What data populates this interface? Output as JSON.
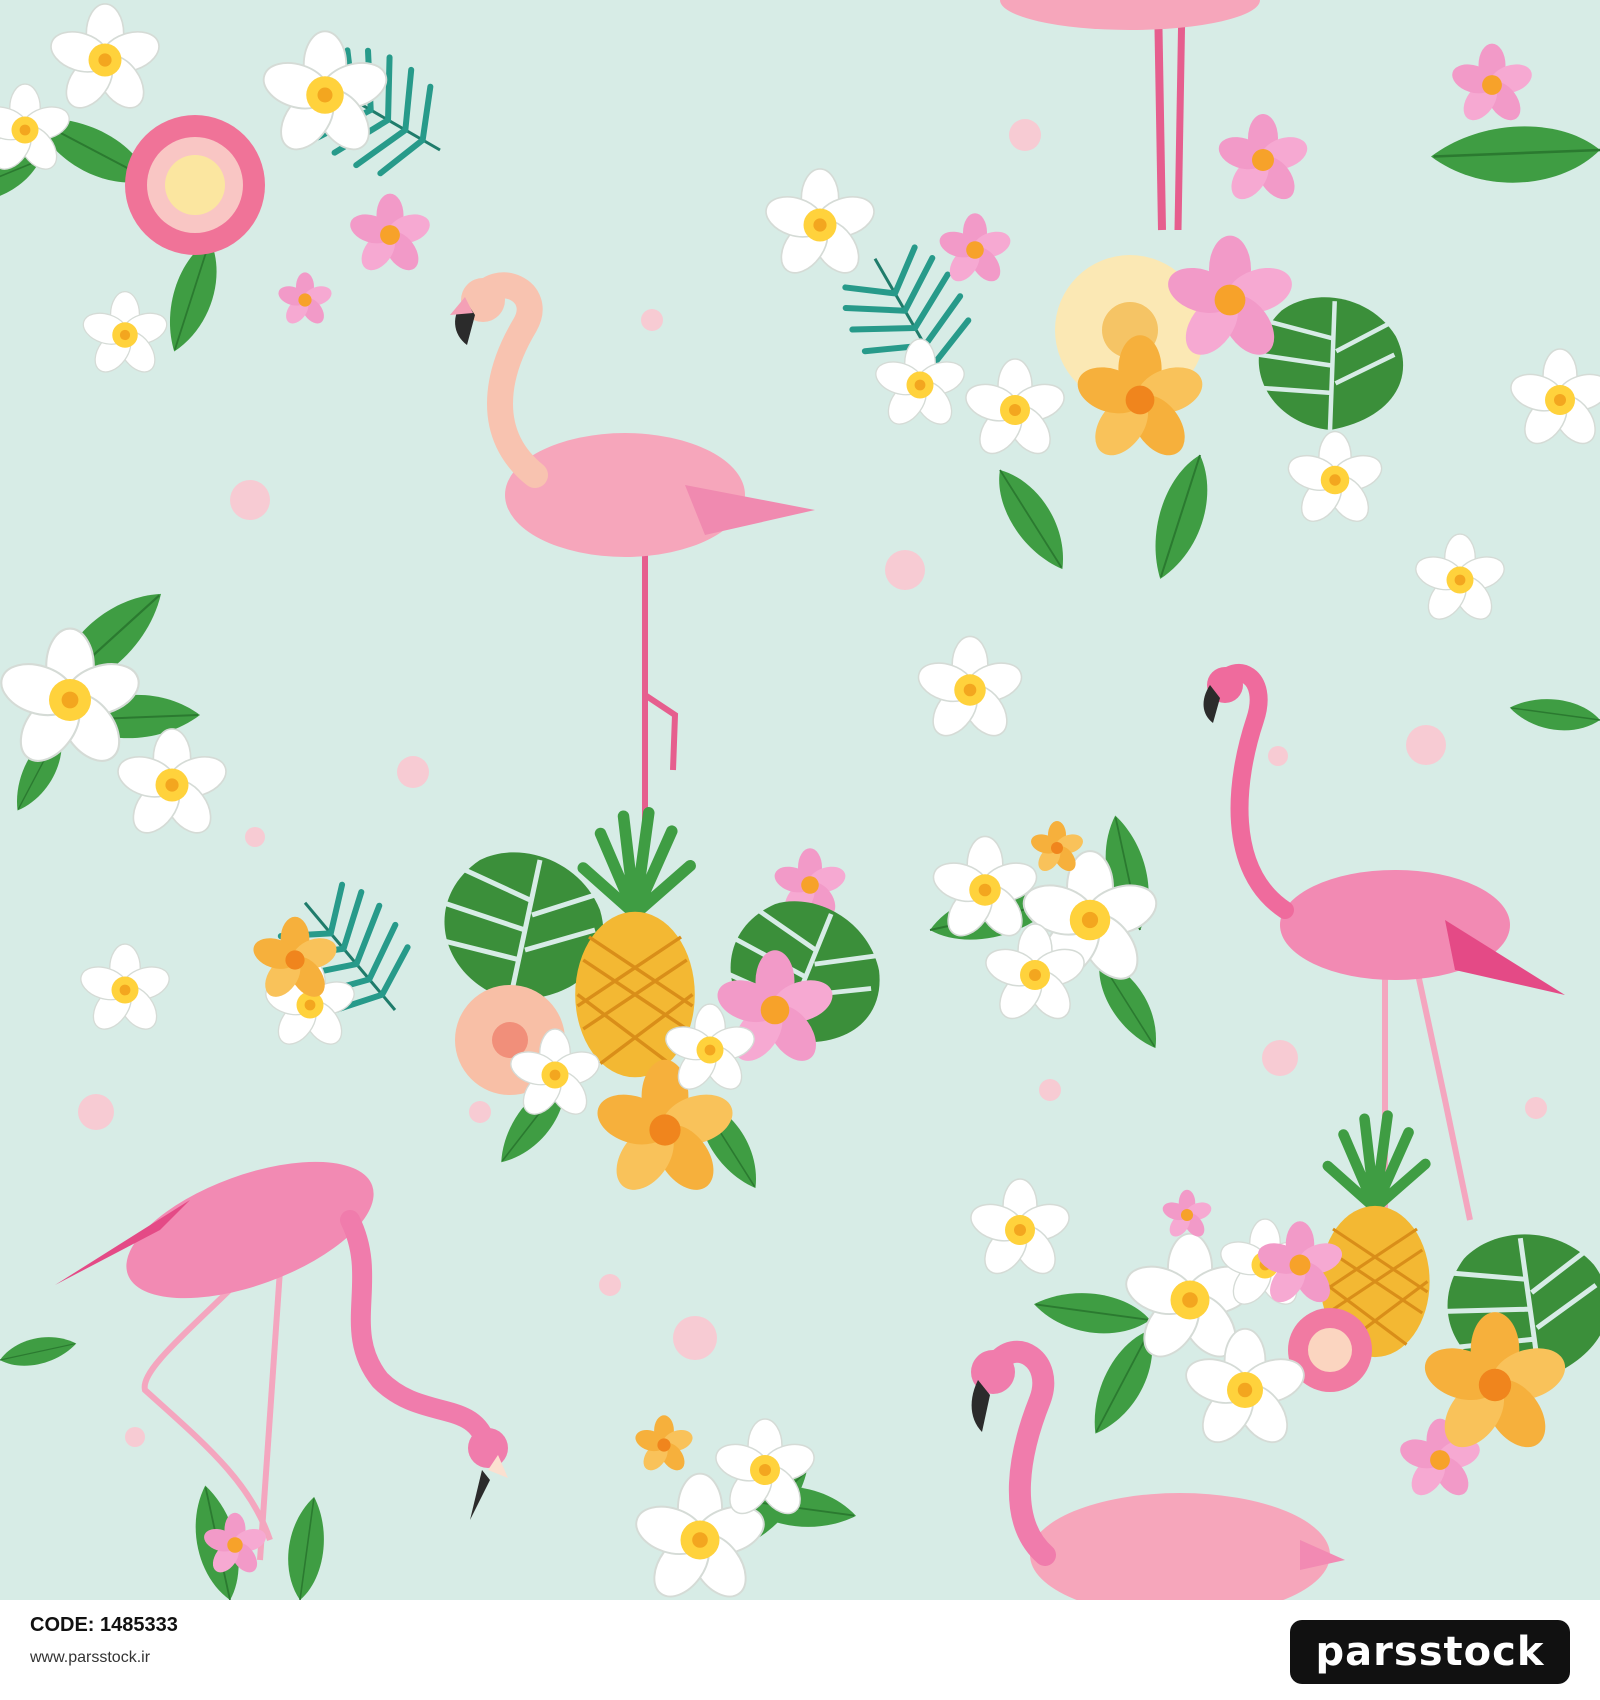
{
  "image": {
    "subject": "seamless tropical pattern",
    "palette": {
      "background": "#d7ece6",
      "flamingo_light": "#f9c9b0",
      "flamingo_pink": "#f08ab0",
      "flamingo_dark": "#e44a86",
      "leaf_green": "#3f9d43",
      "palm_teal": "#279a8a",
      "flower_white": "#ffffff",
      "flower_yellow": "#ffd23c",
      "pineapple_gold": "#f3b833",
      "dot_pink": "#f7cbd3"
    }
  },
  "footer": {
    "code_label": "CODE:",
    "code_value": "1485333",
    "site_url": "www.parsstock.ir",
    "brand_name": "parsstock"
  }
}
